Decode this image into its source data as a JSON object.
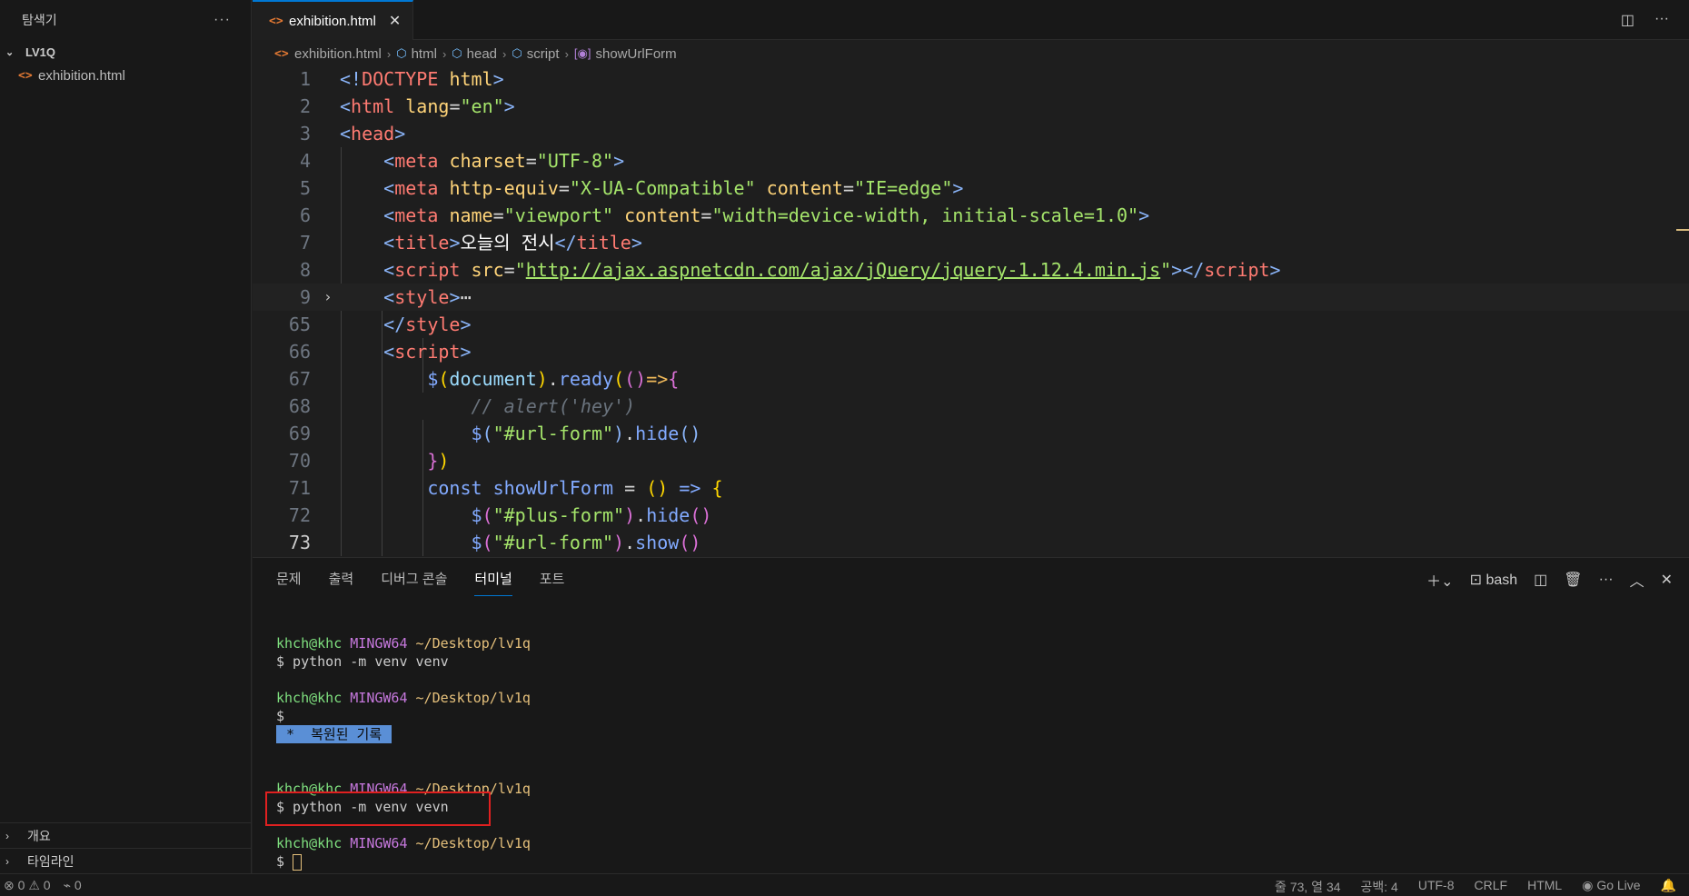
{
  "sidebar": {
    "title": "탐색기",
    "more": "···",
    "folder": "LV1Q",
    "files": [
      "exhibition.html"
    ],
    "sections": [
      "개요",
      "타임라인"
    ]
  },
  "tab": {
    "label": "exhibition.html",
    "close": "✕"
  },
  "breadcrumb": [
    "exhibition.html",
    "html",
    "head",
    "script",
    "showUrlForm"
  ],
  "editor": {
    "line_numbers": [
      "1",
      "2",
      "3",
      "4",
      "5",
      "6",
      "7",
      "8",
      "9",
      "65",
      "66",
      "67",
      "68",
      "69",
      "70",
      "71",
      "72",
      "73"
    ],
    "title_text": "오늘의 전시",
    "url": "http://ajax.aspnetcdn.com/ajax/jQuery/jquery-1.12.4.min.js",
    "comment": "// alert('hey')",
    "sel_url_form": "\"#url-form\"",
    "sel_plus_form": "\"#plus-form\""
  },
  "panel": {
    "tabs": [
      "문제",
      "출력",
      "디버그 콘솔",
      "터미널",
      "포트"
    ],
    "active_tab": "터미널",
    "shell": "bash",
    "terminal": {
      "user": "khch@khc",
      "host": "MINGW64",
      "path": "~/Desktop/lv1q",
      "cmd1": "$ python -m venv venv",
      "prompt": "$",
      "restored": " *  복원된 기록 ",
      "cmd2": "$ python -m venv vevn"
    }
  },
  "status": {
    "errors": "0",
    "warnings": "0",
    "ports": "0",
    "position": "줄 73, 열 34",
    "spaces": "공백: 4",
    "encoding": "UTF-8",
    "eol": "CRLF",
    "language": "HTML",
    "golive": "Go Live"
  }
}
